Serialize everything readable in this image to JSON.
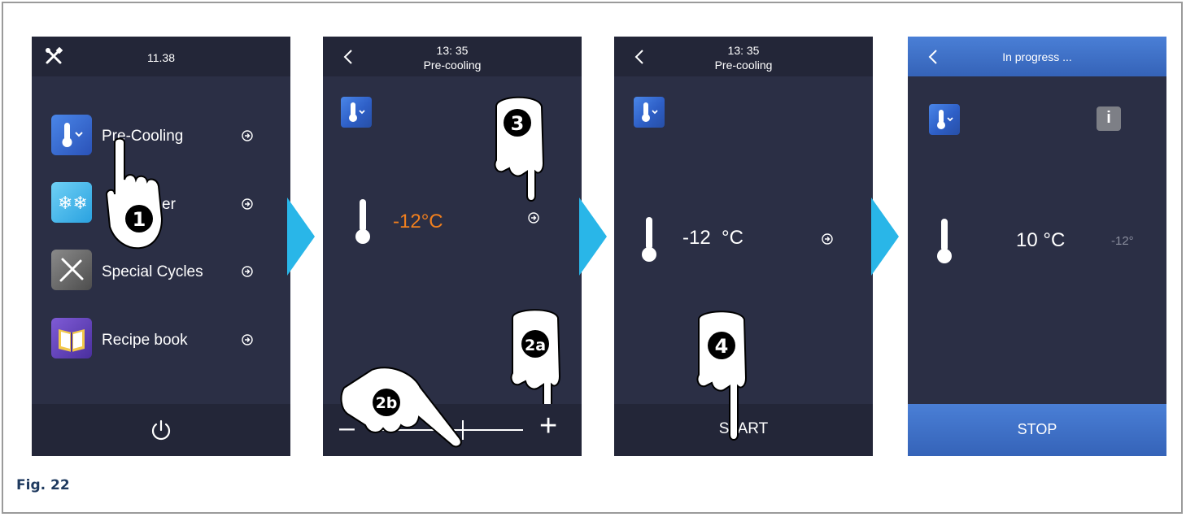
{
  "figure": {
    "caption": "Fig. 22"
  },
  "screen1": {
    "time": "11.38",
    "menu": [
      {
        "label": "Pre-Cooling"
      },
      {
        "label": "er"
      },
      {
        "label": "Special Cycles"
      },
      {
        "label": "Recipe book"
      }
    ],
    "step_marker": "1"
  },
  "screen2": {
    "time": "13: 35",
    "subtitle": "Pre-cooling",
    "temperature": "-12°C",
    "slider_minus": "–",
    "slider_plus": "+",
    "step_markers": {
      "go": "3",
      "plus": "2a",
      "slider": "2b"
    }
  },
  "screen3": {
    "time": "13: 35",
    "subtitle": "Pre-cooling",
    "temperature": "-12  °C",
    "start_label": "START",
    "step_marker": "4"
  },
  "screen4": {
    "title": "In progress ...",
    "current_temperature": "10 °C",
    "target_temperature": "-12°",
    "stop_label": "STOP",
    "info_label": "i"
  },
  "colors": {
    "screen_bg": "#2b2f45",
    "bar_bg": "#232638",
    "accent_orange": "#f07f1e",
    "arrow_cyan": "#29b6e8",
    "blue_bar": "#3d6fc8"
  }
}
